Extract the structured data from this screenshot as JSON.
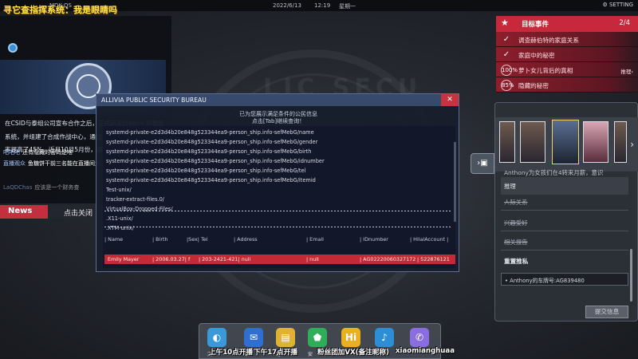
{
  "topbar": {
    "os_label": "MDK-OS",
    "date": "2022/6/13",
    "time": "12:19",
    "weekday": "星期一",
    "setting": "SETTING"
  },
  "overlay": {
    "title": "寻它查指挥系统：我是眼睛吗"
  },
  "background": {
    "seal_text": "LIC SECU"
  },
  "news": {
    "paragraph": "在CSID与泰组公司宣布合作之后，正式研发出Van+ AI智能系统，并组建了合成作战中心，通过使用大量侵财案件破案率提高了45%，近月10月5月份，研利系统有了重大发",
    "chat": [
      {
        "nick": "吧吧吧",
        "text": "还有隐藏的密码是啥"
      },
      {
        "nick": "直播观众",
        "text": "鱼糖饼干前三名能在直播间为上有什么"
      },
      {
        "nick": "LaQDChas",
        "text": "应该是一个财务查"
      }
    ],
    "tag": "News",
    "close": "点击关闭"
  },
  "events": {
    "title": "目标事件",
    "count": "2/4",
    "items": [
      {
        "mark": "✓",
        "label": "调查赫伯特的家庭关系",
        "side": ""
      },
      {
        "mark": "✓",
        "label": "家庭中的秘密",
        "side": ""
      },
      {
        "mark": "100%",
        "label": "萝卜女儿背后的真相",
        "side": "推理›"
      },
      {
        "mark": "85%",
        "label": "隐藏的秘密",
        "side": ""
      }
    ]
  },
  "evidence": {
    "clues": [
      "Anthony为女孩们在4转来月薪，意识",
      "推理",
      "人际关系",
      "兴趣爱好",
      "相关报告"
    ],
    "section": "重置推私",
    "selected": "Anthony的车牌号:AG839480",
    "submit": "提交信息"
  },
  "window": {
    "title": "ALLIVIA PUBLIC SECURITY BUREAU",
    "banner_line1": "已为您展示满足条件的公民信息",
    "banner_line2": "点击[Tab]继续查询！",
    "lines": [
      "systemd-private-e2d3d4b20e848g523344ea9-person_ship.info-sefMebG/name",
      "systemd-private-e2d3d4b20e848g523344ea9-person_ship.info-sefMebG/gender",
      "systemd-private-e2d3d4b20e848g523344ea9-person_ship.info-sefMebG/birth",
      "systemd-private-e2d3d4b20e848g523344ea9-person_ship.info-sefMebG/idnumber",
      "systemd-private-e2d3d4b20e848g523344ea9-person_ship.info-sefMebG/tel",
      "systemd-private-e2d3d4b20e848g523344ea9-person_ship.info-sefMebG/itemid",
      "Test-unix/",
      "tracker-extract-files.0/",
      "VirtualBox-Dropped-Files/",
      ".X11-unix/",
      ".XTM-unix/"
    ],
    "headers": [
      "| Name",
      "| Birth",
      "|Sex| Tel",
      "| Address",
      "| Email",
      "| IDnumber",
      "| HilalAccount |"
    ],
    "row": [
      "Emily Mayer",
      "| 2006.03.27| f",
      "| 203-2421-421| null",
      "",
      "| null",
      "| AG02220060327172",
      "| 522876121"
    ]
  },
  "dock": {
    "icons": [
      {
        "name": "browser",
        "glyph": "◐",
        "color": "#3a9ad9",
        "label": "浏"
      },
      {
        "name": "mail",
        "glyph": "✉",
        "color": "#2f6fd1",
        "label": "邮"
      },
      {
        "name": "notes",
        "glyph": "▤",
        "color": "#e0b234",
        "label": "笔"
      },
      {
        "name": "security",
        "glyph": "⬟",
        "color": "#2fae5a",
        "label": "安"
      },
      {
        "name": "hi-app",
        "glyph": "Hi",
        "color": "#e9b21c",
        "label": ""
      },
      {
        "name": "link",
        "glyph": "♪",
        "color": "#2c8fd6",
        "label": ""
      },
      {
        "name": "phone",
        "glyph": "✆",
        "color": "#8a6de0",
        "label": ""
      }
    ]
  },
  "subtitles": [
    "上午10点开播",
    "下午17点开播",
    "粉丝团加VX(备注昵称)",
    "xiaomianghuaa"
  ]
}
